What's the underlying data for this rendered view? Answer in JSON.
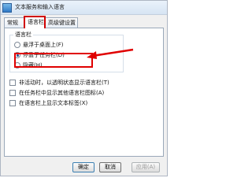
{
  "window": {
    "title": "文本服务和输入语言"
  },
  "tabs": [
    {
      "label": "常规"
    },
    {
      "label": "语言栏"
    },
    {
      "label": "高级键设置"
    }
  ],
  "language_bar": {
    "group_label": "语言栏",
    "options": [
      {
        "label": "悬浮于桌面上(F)",
        "selected": false
      },
      {
        "label": "停靠于任务栏(D)",
        "selected": true
      },
      {
        "label": "隐藏(H)",
        "selected": false
      }
    ],
    "checkboxes": [
      {
        "label": "非活动时，以透明状态显示语言栏(T)",
        "checked": false
      },
      {
        "label": "在任务栏中显示其他语言栏图标(A)",
        "checked": false
      },
      {
        "label": "在语言栏上显示文本标签(X)",
        "checked": false
      }
    ]
  },
  "buttons": {
    "ok": "确定",
    "cancel": "取消",
    "apply": "应用(A)"
  },
  "colors": {
    "highlight": "#e00000",
    "accent": "#1f4f91"
  }
}
